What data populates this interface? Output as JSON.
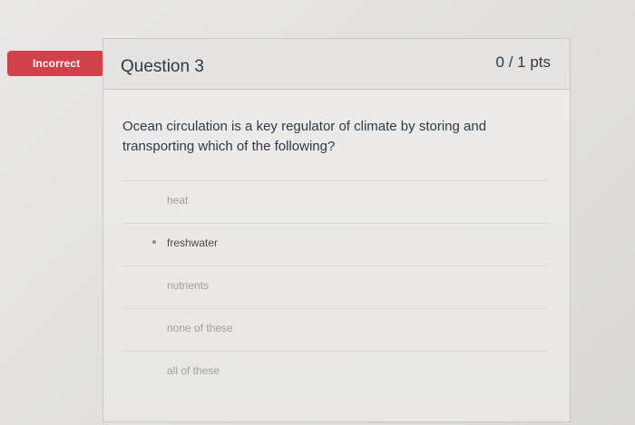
{
  "badge": {
    "label": "Incorrect",
    "color": "#d0414a"
  },
  "question": {
    "title": "Question 3",
    "points": "0 / 1 pts",
    "text": "Ocean circulation is a key regulator of climate by storing and transporting which of the following?"
  },
  "answers": [
    {
      "label": "heat",
      "selected": false
    },
    {
      "label": "freshwater",
      "selected": true
    },
    {
      "label": "nutrients",
      "selected": false
    },
    {
      "label": "none of these",
      "selected": false
    },
    {
      "label": "all of these",
      "selected": false
    }
  ]
}
